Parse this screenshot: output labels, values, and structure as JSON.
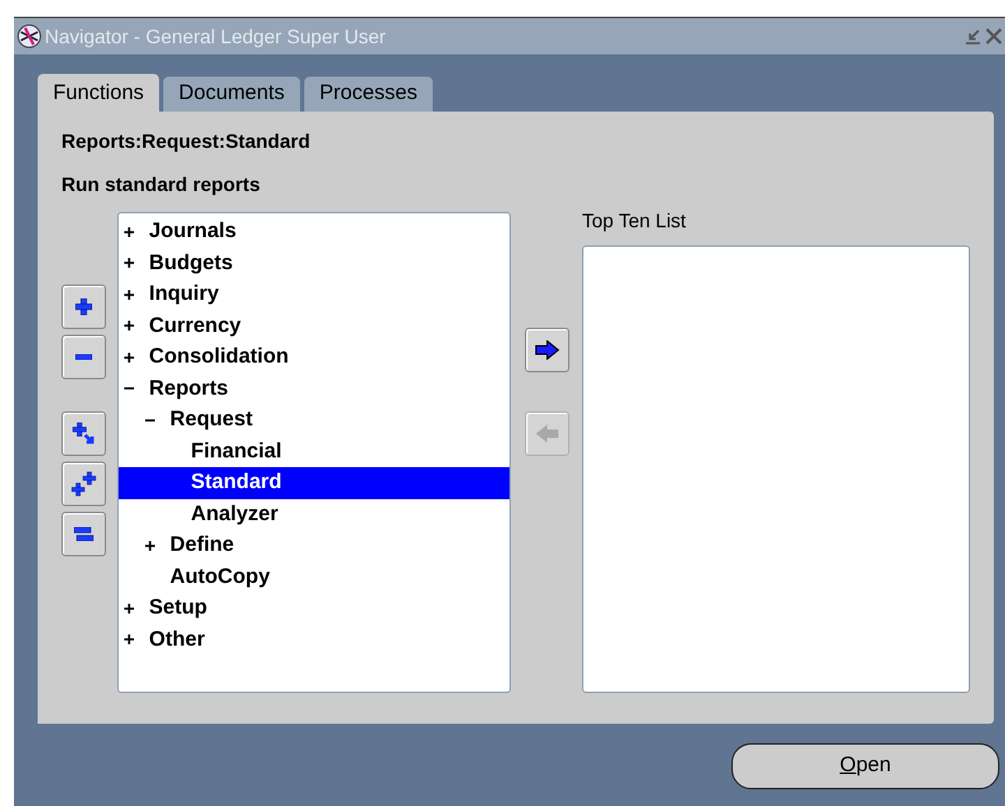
{
  "window": {
    "title": "Navigator - General Ledger Super User"
  },
  "tabs": [
    {
      "label": "Functions",
      "selected": true
    },
    {
      "label": "Documents",
      "selected": false
    },
    {
      "label": "Processes",
      "selected": false
    }
  ],
  "path": "Reports:Request:Standard",
  "description": "Run standard reports",
  "tree_tools": [
    {
      "kind": "expand"
    },
    {
      "kind": "collapse"
    },
    {
      "kind": "expand-branch"
    },
    {
      "kind": "expand-all"
    },
    {
      "kind": "collapse-all"
    }
  ],
  "tree": [
    {
      "label": "Journals",
      "expanded": false,
      "selected": false
    },
    {
      "label": "Budgets",
      "expanded": false,
      "selected": false
    },
    {
      "label": "Inquiry",
      "expanded": false,
      "selected": false
    },
    {
      "label": "Currency",
      "expanded": false,
      "selected": false
    },
    {
      "label": "Consolidation",
      "expanded": false,
      "selected": false
    },
    {
      "label": "Reports",
      "expanded": true,
      "selected": false,
      "children": [
        {
          "label": "Request",
          "expanded": true,
          "selected": false,
          "children": [
            {
              "label": "Financial",
              "selected": false
            },
            {
              "label": "Standard",
              "selected": true
            },
            {
              "label": "Analyzer",
              "selected": false
            }
          ]
        },
        {
          "label": "Define",
          "expanded": false,
          "selected": false
        },
        {
          "label": "AutoCopy",
          "selected": false
        }
      ]
    },
    {
      "label": "Setup",
      "expanded": false,
      "selected": false
    },
    {
      "label": "Other",
      "expanded": false,
      "selected": false
    }
  ],
  "transfer_buttons": [
    {
      "kind": "add",
      "disabled": false
    },
    {
      "kind": "remove",
      "disabled": true
    }
  ],
  "top_ten": {
    "label": "Top Ten List"
  },
  "open_button": {
    "label": "Open",
    "first_letter_underlined": true
  }
}
